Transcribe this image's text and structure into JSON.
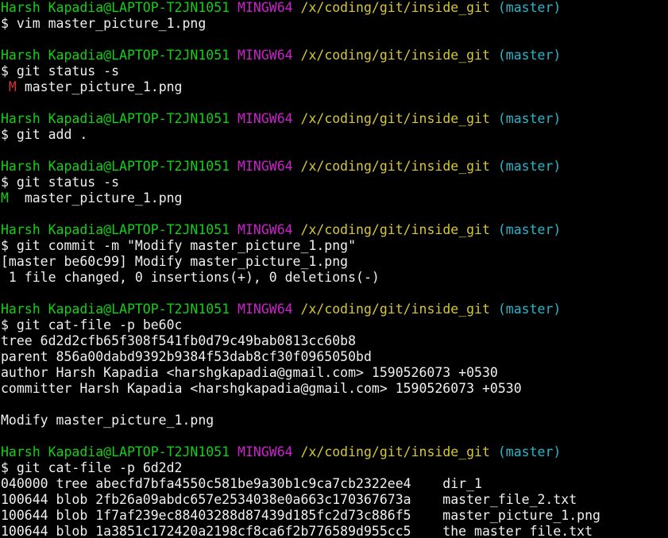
{
  "colors": {
    "background": "#000000",
    "text": "#f0f0f0",
    "user_host": "#11d116",
    "msystem": "#cc22cc",
    "path": "#d6c733",
    "branch": "#25b8cd",
    "modified": "#d43533",
    "staged": "#11d116"
  },
  "prompt": {
    "user_host": "Harsh Kapadia@LAPTOP-T2JN1051",
    "msystem": "MINGW64",
    "cwd": "/x/coding/git/inside_git",
    "branch": "(master)",
    "symbol": "$"
  },
  "blocks": [
    {
      "command": "vim master_picture_1.png",
      "output": []
    },
    {
      "command": "git status -s",
      "status_line": {
        "flag": " M",
        "file": "master_picture_1.png"
      },
      "output": []
    },
    {
      "command": "git add .",
      "output": []
    },
    {
      "command": "git status -s",
      "status_line": {
        "flag": "M ",
        "file": "master_picture_1.png"
      },
      "output": []
    },
    {
      "command": "git commit -m \"Modify master_picture_1.png\"",
      "output": [
        "[master be60c99] Modify master_picture_1.png",
        " 1 file changed, 0 insertions(+), 0 deletions(-)"
      ]
    },
    {
      "command": "git cat-file -p be60c",
      "output": [
        "tree 6d2d2cfb65f308f541fb0d79c49bab0813cc60b8",
        "parent 856a00dabd9392b9384f53dab8cf30f0965050bd",
        "author Harsh Kapadia <harshgkapadia@gmail.com> 1590526073 +0530",
        "committer Harsh Kapadia <harshgkapadia@gmail.com> 1590526073 +0530",
        "",
        "Modify master_picture_1.png"
      ]
    },
    {
      "command": "git cat-file -p 6d2d2",
      "output": [
        "040000 tree abecfd7bfa4550c581be9a30b1c9ca7cb2322ee4    dir_1",
        "100644 blob 2fb26a09abdc657e2534038e0a663c170367673a    master_file_2.txt",
        "100644 blob 1f7af239ec88403288d87439d185fc2d73c886f5    master_picture_1.png",
        "100644 blob 1a3851c172420a2198cf8ca6f2b776589d955cc5    the_master_file.txt"
      ]
    }
  ]
}
